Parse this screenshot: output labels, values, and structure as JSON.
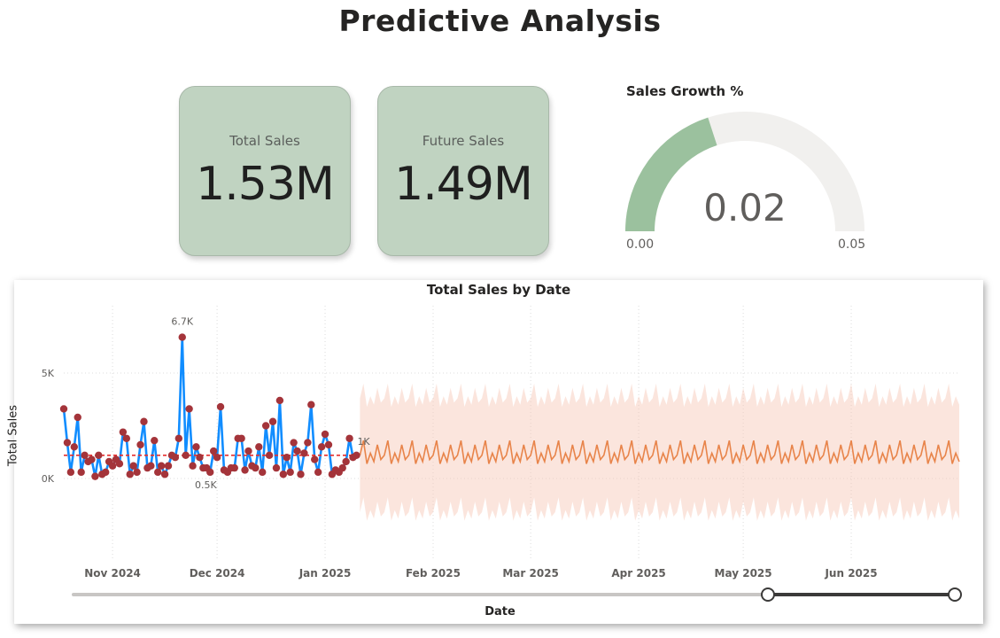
{
  "page_title": "Predictive Analysis",
  "cards": [
    {
      "label": "Total Sales",
      "value": "1.53M"
    },
    {
      "label": "Future Sales",
      "value": "1.49M"
    }
  ],
  "gauge": {
    "title": "Sales Growth %",
    "value": 0.02,
    "value_label": "0.02",
    "min": 0,
    "max": 0.05,
    "min_label": "0.00",
    "max_label": "0.05",
    "fill_color": "#9bc19e",
    "track_color": "#f1f0ee"
  },
  "chart_data": {
    "type": "line",
    "title": "Total Sales by Date",
    "xlabel": "Date",
    "ylabel": "Total Sales",
    "y_ticks": [
      "0K",
      "5K"
    ],
    "x_ticks": [
      "Nov 2024",
      "Dec 2024",
      "Jan 2025",
      "Feb 2025",
      "Mar 2025",
      "Apr 2025",
      "May 2025",
      "Jun 2025"
    ],
    "data_labels": [
      "6.7K",
      "0.5K",
      "1K"
    ],
    "ylim": [
      -2200,
      7800
    ],
    "actual_start": "2024-10-18",
    "actual_values": [
      3300,
      1700,
      300,
      1500,
      2900,
      300,
      1100,
      800,
      900,
      100,
      1100,
      200,
      300,
      800,
      600,
      900,
      700,
      2200,
      1900,
      200,
      600,
      300,
      1600,
      2700,
      500,
      600,
      1800,
      300,
      600,
      200,
      600,
      1100,
      1000,
      1900,
      6700,
      1100,
      3300,
      600,
      1500,
      1000,
      500,
      500,
      300,
      1300,
      1000,
      3400,
      400,
      300,
      500,
      500,
      1900,
      1900,
      400,
      1300,
      600,
      500,
      1500,
      300,
      2500,
      1100,
      2700,
      500,
      3700,
      200,
      1000,
      300,
      1700,
      1300,
      200,
      1200,
      1700,
      3500,
      900,
      300,
      1500,
      2100,
      1600,
      200,
      400,
      300,
      500,
      800,
      1900,
      1000,
      1100
    ],
    "avg_value": 1100,
    "forecast_start": "2025-01-11",
    "forecast_end": "2025-07-02",
    "forecast_base": 1100,
    "forecast_upper_base": 3800,
    "forecast_lower_base": -1600,
    "weekly_pattern": [
      0,
      700,
      -400,
      100,
      -300,
      500,
      -200
    ],
    "colors": {
      "actual_line": "#118dff",
      "actual_markers": "#a4343a",
      "avg_line": "#e52e2e",
      "forecast_line": "#e8844a",
      "forecast_band": "#f6c5b4"
    },
    "grid": true,
    "slider": {
      "range": [
        "2025-04-22",
        "2025-07-02"
      ]
    }
  }
}
